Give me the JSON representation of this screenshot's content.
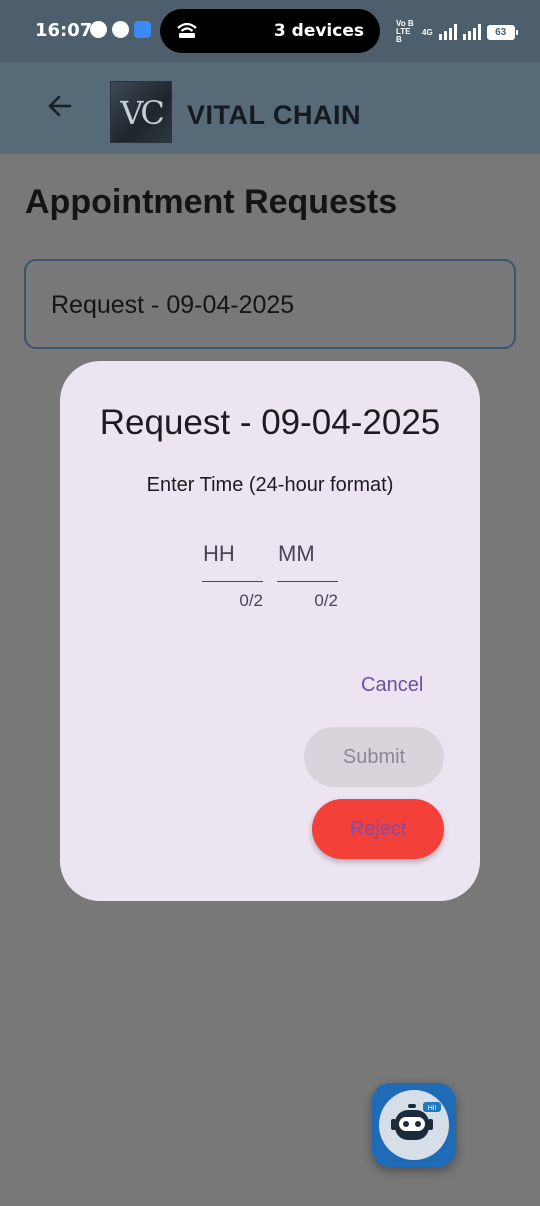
{
  "status_bar": {
    "time": "16:07",
    "hotspot_text": "3 devices",
    "volte_label": "Vo B LTE B",
    "network_label": "4G",
    "battery": "63"
  },
  "app_bar": {
    "logo_text": "VC",
    "title": "VITAL CHAIN",
    "bg_color": "#566a77"
  },
  "page": {
    "title": "Appointment Requests",
    "requests": [
      {
        "label": "Request - 09-04-2025"
      }
    ]
  },
  "dialog": {
    "title": "Request - 09-04-2025",
    "subtitle": "Enter Time (24-hour format)",
    "hour_field": {
      "placeholder": "HH",
      "value": "",
      "counter": "0/2"
    },
    "minute_field": {
      "placeholder": "MM",
      "value": "",
      "counter": "0/2"
    },
    "cancel_label": "Cancel",
    "submit_label": "Submit",
    "reject_label": "Reject",
    "accent_color": "#6a4fa3",
    "reject_color": "#f4403a"
  },
  "chatbot": {
    "badge": "Hi!",
    "icon": "robot-icon"
  }
}
